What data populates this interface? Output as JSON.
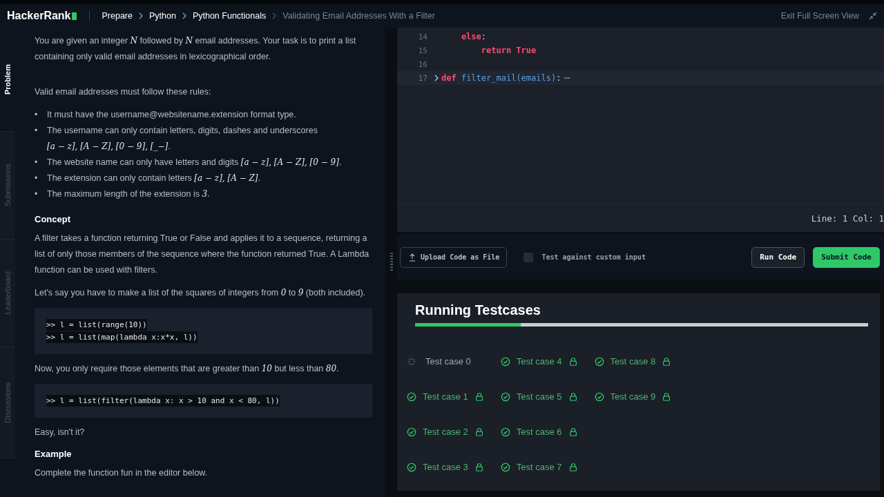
{
  "header": {
    "logo": "HackerRank",
    "breadcrumbs": [
      {
        "label": "Prepare",
        "current": false
      },
      {
        "label": "Python",
        "current": false
      },
      {
        "label": "Python Functionals",
        "current": false
      },
      {
        "label": "Validating Email Addresses With a Filter",
        "current": true
      }
    ],
    "exit_label": "Exit Full Screen View"
  },
  "side_tabs": [
    {
      "label": "Problem",
      "selected": true
    },
    {
      "label": "Submissions",
      "selected": false
    },
    {
      "label": "Leaderboard",
      "selected": false
    },
    {
      "label": "Discussions",
      "selected": false
    }
  ],
  "problem": [
    {
      "kind": "para",
      "parts": [
        {
          "kind": "text",
          "text": "You are given an integer "
        },
        {
          "kind": "math",
          "text": "N"
        },
        {
          "kind": "text",
          "text": " followed by "
        },
        {
          "kind": "math",
          "text": "N"
        },
        {
          "kind": "text",
          "text": " email addresses. Your task is to print a list containing only valid email addresses in lexicographical order."
        }
      ]
    },
    {
      "kind": "para",
      "parts": [
        {
          "kind": "text",
          "text": "Valid email addresses must follow these rules:"
        }
      ]
    },
    {
      "kind": "bullets",
      "marker": "•",
      "items": [
        [
          {
            "kind": "text",
            "text": "It must have the username@websitename.extension format type."
          }
        ],
        [
          {
            "kind": "text",
            "text": "The username can only contain letters, digits, dashes and underscores "
          },
          {
            "kind": "break"
          },
          {
            "kind": "math",
            "text": "[a − z], [A − Z], [0 − 9], [_−]"
          },
          {
            "kind": "text",
            "text": "."
          }
        ],
        [
          {
            "kind": "text",
            "text": "The website name can only have letters and digits "
          },
          {
            "kind": "math",
            "text": "[a − z], [A − Z], [0 − 9]"
          },
          {
            "kind": "text",
            "text": "."
          }
        ],
        [
          {
            "kind": "text",
            "text": "The extension can only contain letters "
          },
          {
            "kind": "math",
            "text": "[a − z], [A − Z]"
          },
          {
            "kind": "text",
            "text": "."
          }
        ],
        [
          {
            "kind": "text",
            "text": "The maximum length of the extension is "
          },
          {
            "kind": "math",
            "text": "3"
          },
          {
            "kind": "text",
            "text": "."
          }
        ]
      ]
    },
    {
      "kind": "heading",
      "text": "Concept"
    },
    {
      "kind": "para",
      "parts": [
        {
          "kind": "text",
          "text": "A filter takes a function returning True or False and applies it to a sequence, returning a list of only those members of the sequence where the function returned True. A Lambda function can be used with filters."
        }
      ]
    },
    {
      "kind": "para",
      "parts": [
        {
          "kind": "text",
          "text": "Let's say you have to make a list of the squares of integers from "
        },
        {
          "kind": "math",
          "text": "0"
        },
        {
          "kind": "text",
          "text": " to "
        },
        {
          "kind": "math",
          "text": "9"
        },
        {
          "kind": "text",
          "text": " (both included)."
        }
      ]
    },
    {
      "kind": "code",
      "lines": [
        ">> l = list(range(10))",
        ">> l = list(map(lambda x:x*x, l))"
      ]
    },
    {
      "kind": "para",
      "parts": [
        {
          "kind": "text",
          "text": "Now, you only require those elements that are greater than "
        },
        {
          "kind": "math",
          "text": "10"
        },
        {
          "kind": "text",
          "text": " but less than "
        },
        {
          "kind": "math",
          "text": "80"
        },
        {
          "kind": "text",
          "text": "."
        }
      ]
    },
    {
      "kind": "code",
      "lines": [
        ">> l = list(filter(lambda x: x > 10 and x < 80, l))"
      ]
    },
    {
      "kind": "para",
      "parts": [
        {
          "kind": "text",
          "text": "Easy, isn't it?"
        }
      ]
    },
    {
      "kind": "heading",
      "text": "Example"
    },
    {
      "kind": "para",
      "parts": [
        {
          "kind": "text",
          "text": "Complete the function fun in the editor below."
        }
      ]
    }
  ],
  "editor": {
    "lines": [
      {
        "number": "14",
        "folded": false,
        "tokens": [
          {
            "kind": "keyword",
            "text": "    else"
          },
          {
            "kind": "plain",
            "text": ":"
          }
        ]
      },
      {
        "number": "15",
        "folded": false,
        "tokens": [
          {
            "kind": "keyword",
            "text": "        return True"
          }
        ]
      },
      {
        "number": "16",
        "folded": false
      },
      {
        "number": "17",
        "folded": true,
        "tokens": [
          {
            "kind": "keyword",
            "text": "def "
          },
          {
            "kind": "name",
            "text": "filter_mail(emails)"
          },
          {
            "kind": "plain",
            "text": ":"
          }
        ]
      }
    ],
    "cursor": "Line: 1 Col: 1"
  },
  "toolbar": {
    "upload": "Upload Code as File",
    "custom_input": {
      "label": "Test against custom input",
      "checked": false
    },
    "run": "Run Code",
    "submit": "Submit Code"
  },
  "results": {
    "title": "Running Testcases",
    "level": 0.233,
    "cases": [
      {
        "label": "Test case 0",
        "passed": false,
        "locked": false
      },
      {
        "label": "Test case 1",
        "passed": true,
        "locked": true
      },
      {
        "label": "Test case 2",
        "passed": true,
        "locked": true
      },
      {
        "label": "Test case 3",
        "passed": true,
        "locked": true
      },
      {
        "label": "Test case 4",
        "passed": true,
        "locked": true
      },
      {
        "label": "Test case 5",
        "passed": true,
        "locked": true
      },
      {
        "label": "Test case 6",
        "passed": true,
        "locked": true
      },
      {
        "label": "Test case 7",
        "passed": true,
        "locked": true
      },
      {
        "label": "Test case 8",
        "passed": true,
        "locked": true
      },
      {
        "label": "Test case 9",
        "passed": true,
        "locked": true
      }
    ]
  }
}
